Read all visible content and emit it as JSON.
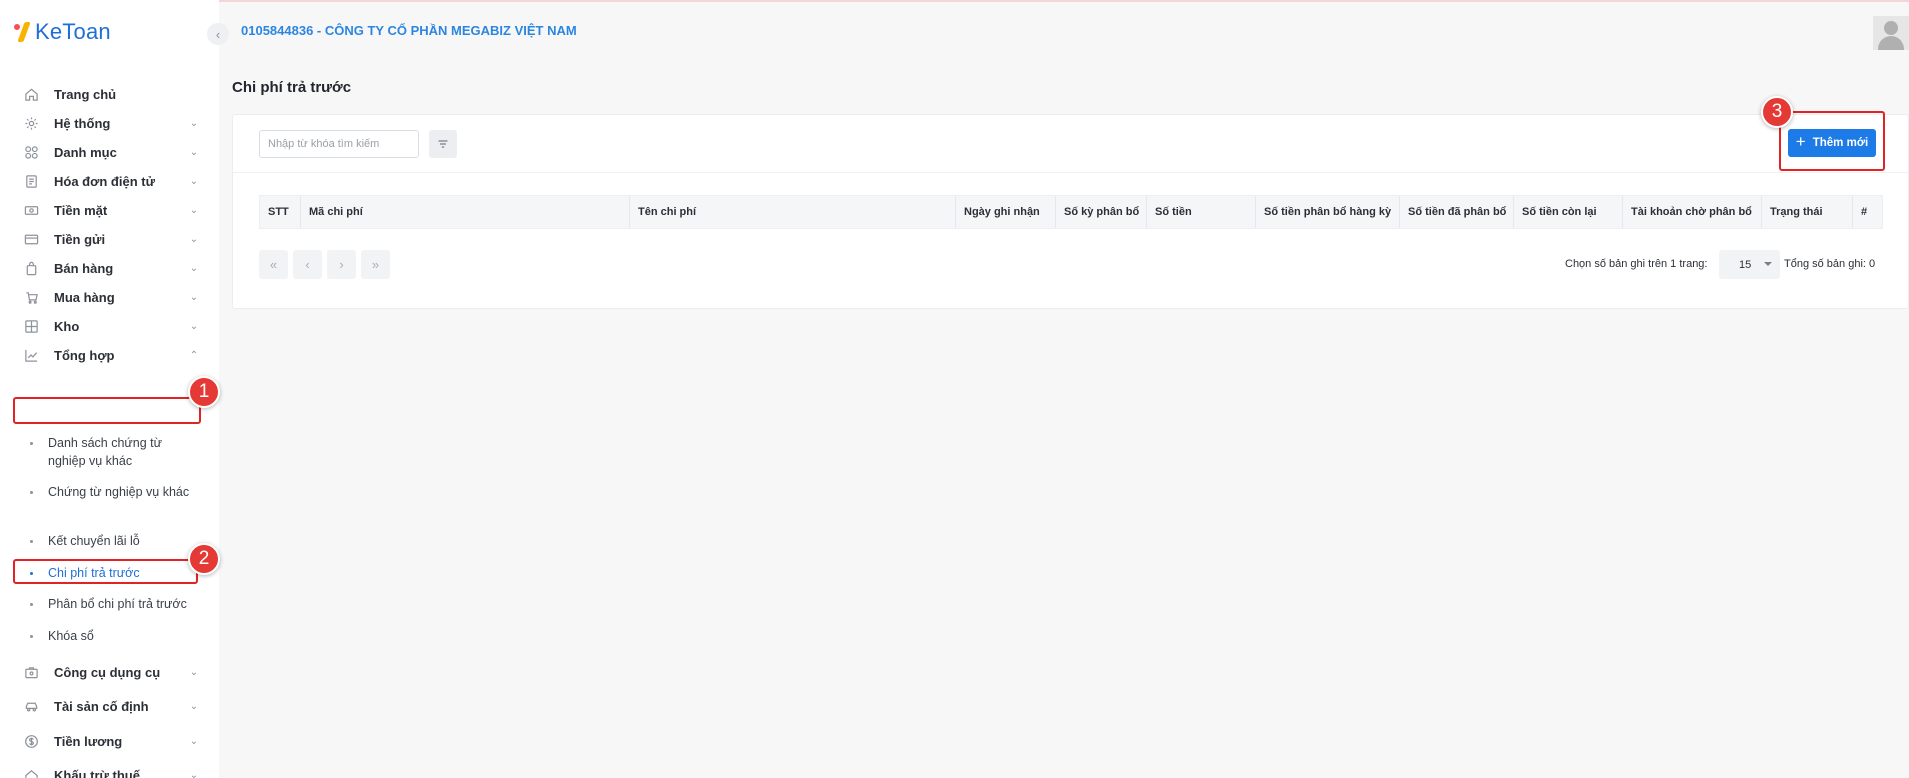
{
  "app": {
    "logo_text": "KeToan"
  },
  "header": {
    "company": "0105844836 - CÔNG TY CỔ PHẦN MEGABIZ VIỆT NAM"
  },
  "sidebar": {
    "items": [
      {
        "label": "Trang chủ",
        "icon": "home-icon"
      },
      {
        "label": "Hệ thống",
        "icon": "gear-icon",
        "chevron": "down"
      },
      {
        "label": "Danh mục",
        "icon": "category-icon",
        "chevron": "down"
      },
      {
        "label": "Hóa đơn điện tử",
        "icon": "invoice-icon",
        "chevron": "down"
      },
      {
        "label": "Tiền mặt",
        "icon": "cash-icon",
        "chevron": "down"
      },
      {
        "label": "Tiền gửi",
        "icon": "card-icon",
        "chevron": "down"
      },
      {
        "label": "Bán hàng",
        "icon": "shopping-bag-icon",
        "chevron": "down"
      },
      {
        "label": "Mua hàng",
        "icon": "cart-icon",
        "chevron": "down"
      },
      {
        "label": "Kho",
        "icon": "warehouse-icon",
        "chevron": "down"
      },
      {
        "label": "Tổng hợp",
        "icon": "chart-line-icon",
        "chevron": "up"
      },
      {
        "label": "Công cụ dụng cụ",
        "icon": "tools-icon",
        "chevron": "down"
      },
      {
        "label": "Tài sản cố định",
        "icon": "car-icon",
        "chevron": "down"
      },
      {
        "label": "Tiền lương",
        "icon": "dollar-icon",
        "chevron": "down"
      },
      {
        "label": "Khấu trừ thuế",
        "icon": "tax-icon",
        "chevron": "down"
      }
    ],
    "subitems": [
      {
        "label": "Danh sách chứng từ nghiệp vụ khác"
      },
      {
        "label": "Chứng từ nghiệp vụ khác"
      },
      {
        "label": "Kết chuyển lãi lỗ"
      },
      {
        "label": "Chi phí trả trước"
      },
      {
        "label": "Phân bổ chi phí trả trước"
      },
      {
        "label": "Khóa sổ"
      }
    ]
  },
  "annotations": {
    "badge1": "1",
    "badge2": "2",
    "badge3": "3"
  },
  "page": {
    "title": "Chi phí trả trước"
  },
  "toolbar": {
    "search_placeholder": "Nhập từ khóa tìm kiếm",
    "add_label": "Thêm mới"
  },
  "table": {
    "columns": [
      "STT",
      "Mã chi phí",
      "Tên chi phí",
      "Ngày ghi nhận",
      "Số kỳ phân bổ",
      "Số tiền",
      "Số tiền phân bổ hàng kỳ",
      "Số tiền đã phân bổ",
      "Số tiền còn lại",
      "Tài khoản chờ phân bổ",
      "Trạng thái",
      "#"
    ]
  },
  "pagination": {
    "per_page_label": "Chọn số bản ghi trên 1 trang:",
    "per_page_value": "15",
    "total_label": "Tổng số bản ghi: 0"
  },
  "colors": {
    "accent": "#1d7be8",
    "brand": "#1f6fd6",
    "highlight": "#e02424"
  }
}
